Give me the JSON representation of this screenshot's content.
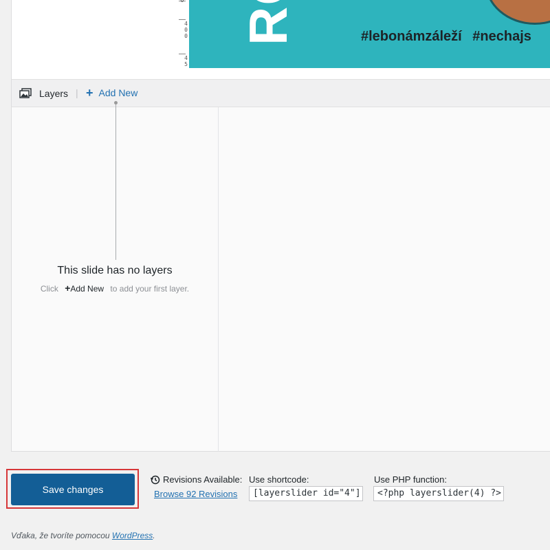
{
  "preview": {
    "big_letters": "RO",
    "hashtags": "#lebonámzáleží #nechajs",
    "ruler_ticks": [
      "0",
      "400",
      "45"
    ]
  },
  "layers_bar": {
    "icon": "layers-icon",
    "label": "Layers",
    "separator": "|",
    "add_new": {
      "icon": "plus-icon",
      "label": "Add New"
    }
  },
  "empty_state": {
    "title": "This slide has no layers",
    "hint_before": "Click",
    "hint_add": "Add New",
    "hint_after": "to add your first layer."
  },
  "actions": {
    "save_label": "Save changes",
    "revisions_label": "Revisions Available:",
    "revisions_icon": "history-icon",
    "revisions_link": "Browse 92 Revisions",
    "shortcode_label": "Use shortcode:",
    "shortcode_value": "[layerslider id=\"4\"]",
    "php_label": "Use PHP function:",
    "php_value": "<?php layerslider(4) ?>"
  },
  "footer": {
    "text_before": "Vďaka, že tvoríte pomocou",
    "link": "WordPress",
    "text_after": "."
  },
  "colors": {
    "accent": "#2271b1",
    "save_button": "#135e96",
    "highlight": "#d63638",
    "preview_bg": "#2eb4bd"
  }
}
